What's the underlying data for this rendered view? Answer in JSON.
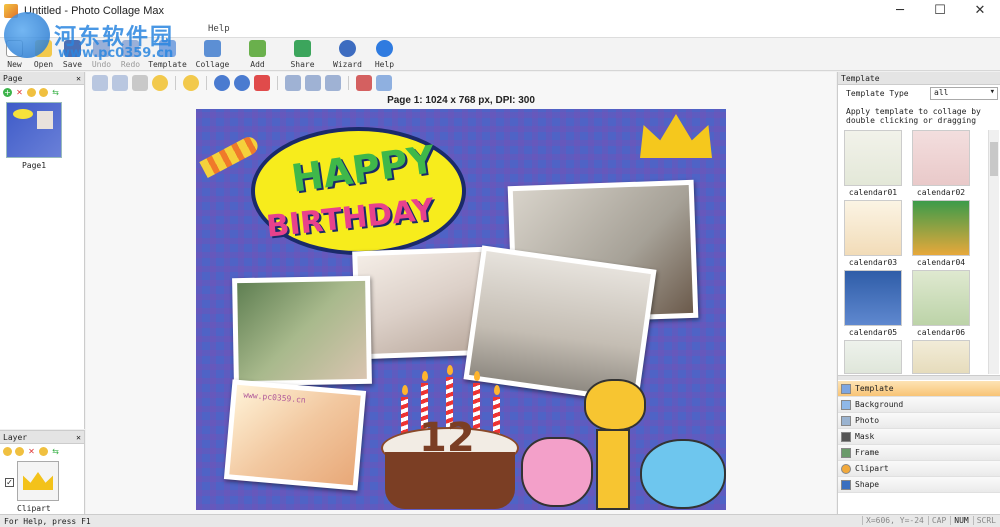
{
  "window": {
    "title": "Untitled - Photo Collage Max",
    "minimize": "─",
    "maximize": "☐",
    "close": "✕"
  },
  "watermark": {
    "title": "河东软件园",
    "url": "www.pc0359.cn"
  },
  "menu": {
    "items": [
      "Help"
    ]
  },
  "toolbar": {
    "new": "New",
    "open": "Open",
    "save": "Save",
    "undo": "Undo",
    "redo": "Redo",
    "template": "Template",
    "collage": "Collage",
    "add": "Add",
    "share": "Share",
    "wizard": "Wizard",
    "help": "Help"
  },
  "page_panel": {
    "title": "Page",
    "close": "✕",
    "pin": "📌",
    "page_label": "Page1"
  },
  "layer_panel": {
    "title": "Layer",
    "close": "✕",
    "layer_label": "Clipart",
    "checked": "✓"
  },
  "canvas": {
    "page_info": "Page 1: 1024 x 768 px, DPI: 300",
    "collage_word1": "HAPPY",
    "collage_word2": "BIRTHDAY",
    "cake_number": "12",
    "photo_watermark": "www.pc0359.cn"
  },
  "right_panel": {
    "title": "Template",
    "type_label": "Template Type",
    "type_value": "all",
    "description": "Apply template to collage by double clicking or dragging",
    "templates": [
      "calendar01",
      "calendar02",
      "calendar03",
      "calendar04",
      "calendar05",
      "calendar06"
    ],
    "categories": [
      "Template",
      "Background",
      "Photo",
      "Mask",
      "Frame",
      "Clipart",
      "Shape"
    ],
    "active_category": "Template"
  },
  "statusbar": {
    "text": "For Help, press F1",
    "coords": "X=606, Y=-24",
    "cap": "CAP",
    "num": "NUM",
    "scrl": "SCRL"
  }
}
